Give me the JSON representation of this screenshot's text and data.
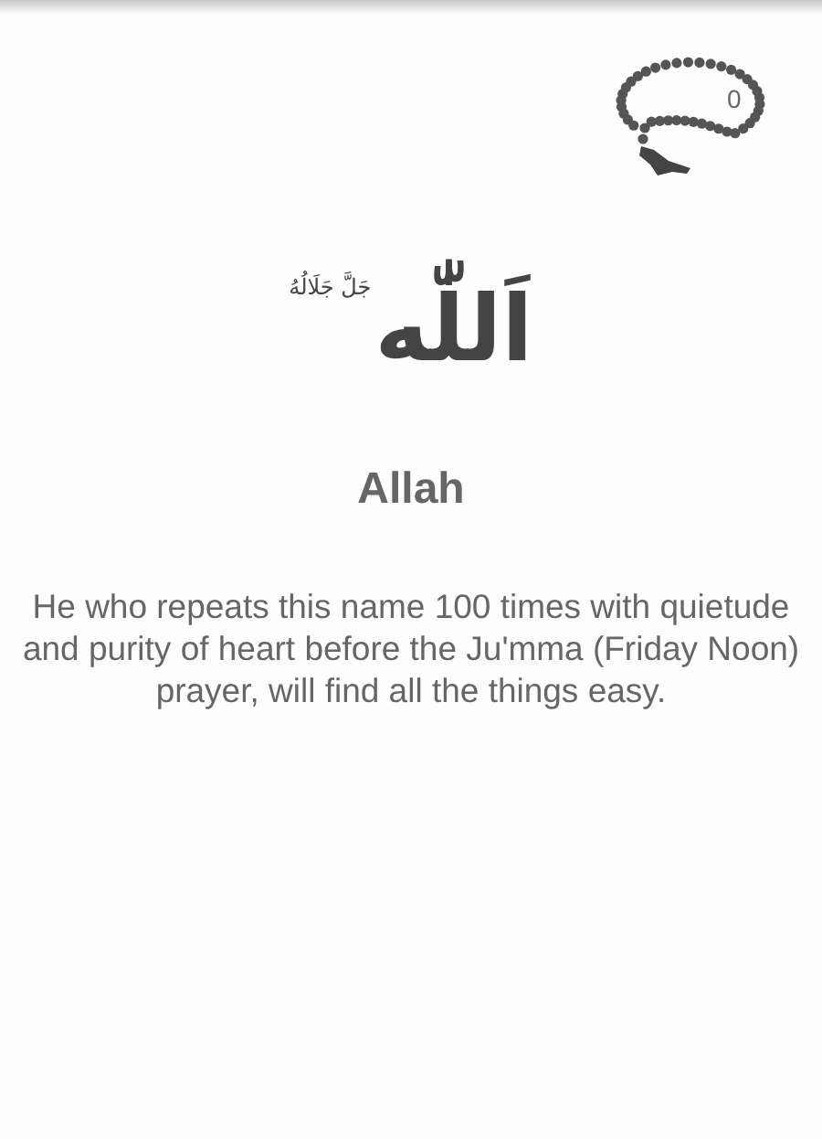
{
  "counter": "0",
  "calligraphy": {
    "name": "اَللّٰه",
    "honorific": "جَلَّ جَلَالُهُ"
  },
  "title": "Allah",
  "description": "He who repeats this name 100 times with quietude and purity of heart before the Ju'mma (Friday Noon) prayer, will find all the things easy."
}
